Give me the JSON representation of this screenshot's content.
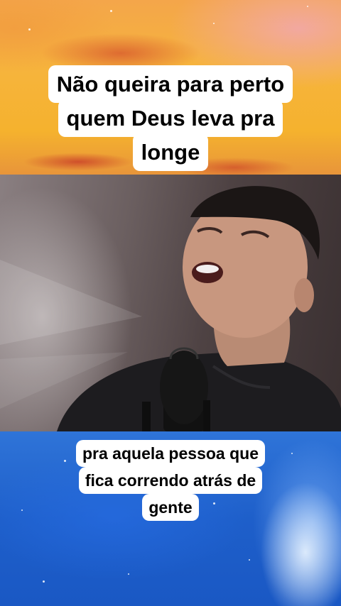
{
  "captions": {
    "top": "Não queira para perto quem Deus leva pra longe",
    "bottom": "pra aquela pessoa que fica correndo atrás de gente"
  },
  "colors": {
    "caption_background": "#ffffff",
    "caption_text": "#000000",
    "sunset_orange": "#f5b22e",
    "sky_pink": "#f2a8aa",
    "galaxy_blue": "#1e5fca"
  }
}
